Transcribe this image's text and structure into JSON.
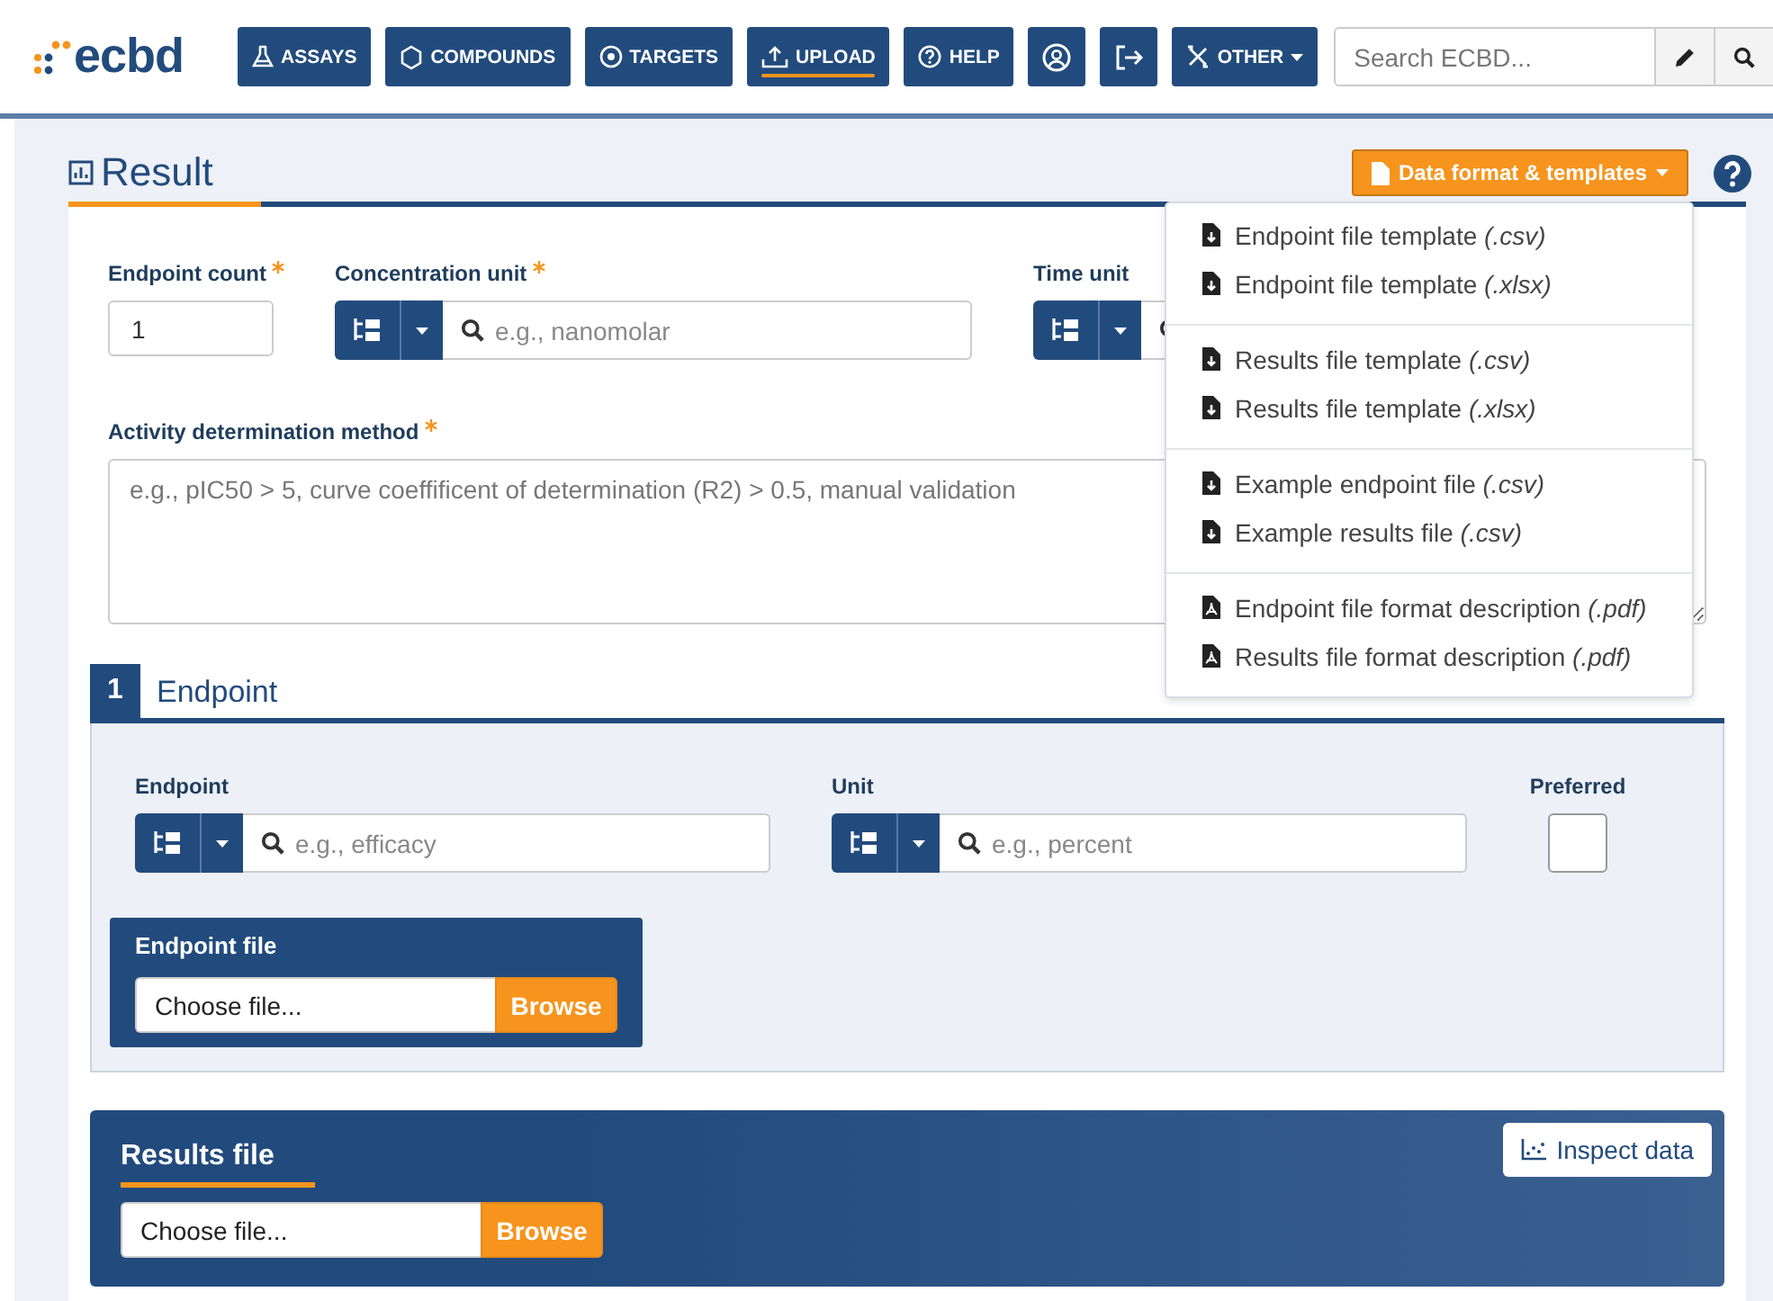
{
  "header": {
    "logo": "ecbd",
    "nav": [
      {
        "label": "ASSAYS",
        "selected": false
      },
      {
        "label": "COMPOUNDS",
        "selected": false
      },
      {
        "label": "TARGETS",
        "selected": false
      },
      {
        "label": "UPLOAD",
        "selected": true
      },
      {
        "label": "HELP",
        "selected": false
      },
      {
        "selected": false
      },
      {
        "selected": false
      },
      {
        "label": "OTHER",
        "selected": false,
        "dropdown": true
      }
    ],
    "search": {
      "placeholder": "Search ECBD..."
    }
  },
  "result": {
    "title": "Result",
    "templates_button": "Data format & templates",
    "menu": [
      {
        "items": [
          {
            "kind": "download",
            "label": "Endpoint file template *(.csv)*"
          },
          {
            "kind": "download",
            "label": "Endpoint file template *(.xlsx)*"
          }
        ]
      },
      {
        "items": [
          {
            "kind": "download",
            "label": "Results file template *(.csv)*"
          },
          {
            "kind": "download",
            "label": "Results file template *(.xlsx)*"
          }
        ]
      },
      {
        "items": [
          {
            "kind": "download",
            "label": "Example endpoint file *(.csv)*"
          },
          {
            "kind": "download",
            "label": "Example results file *(.csv)*"
          }
        ]
      },
      {
        "items": [
          {
            "kind": "pdf",
            "label": "Endpoint file format description *(.pdf)*"
          },
          {
            "kind": "pdf",
            "label": "Results file format description *(.pdf)*"
          }
        ]
      }
    ],
    "endpoint_count": {
      "label": "Endpoint count",
      "required": true,
      "value": "1"
    },
    "concentration_unit": {
      "label": "Concentration unit",
      "required": true,
      "placeholder": "e.g., nanomolar"
    },
    "time_unit": {
      "label": "Time unit"
    },
    "activity_method": {
      "label": "Activity determination method",
      "required": true,
      "placeholder": "e.g., pIC50 > 5, curve coeffificent of determination (R2) > 0.5, manual validation"
    }
  },
  "endpoint": {
    "number": "1",
    "title": "Endpoint",
    "endpoint": {
      "label": "Endpoint",
      "placeholder": "e.g., efficacy"
    },
    "unit": {
      "label": "Unit",
      "placeholder": "e.g., percent"
    },
    "preferred": {
      "label": "Preferred",
      "checked": false
    },
    "endpoint_file": {
      "label": "Endpoint file",
      "placeholder": "Choose file...",
      "button": "Browse"
    }
  },
  "results_file": {
    "label": "Results file",
    "placeholder": "Choose file...",
    "button": "Browse",
    "inspect_button": "Inspect data"
  }
}
